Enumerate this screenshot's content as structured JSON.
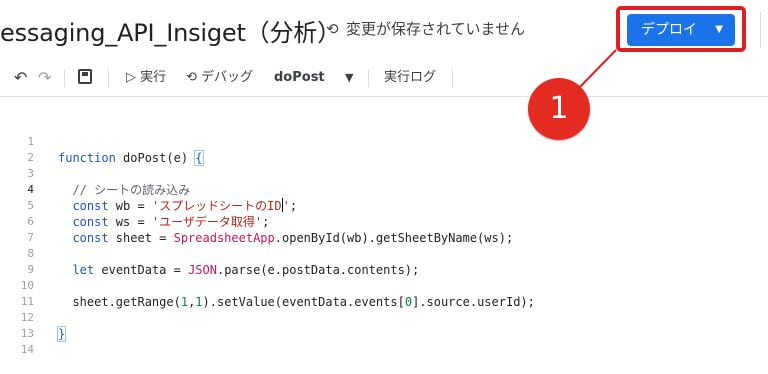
{
  "header": {
    "project_title": "essaging_API_Insiget（分析）",
    "save_status": "変更が保存されていません",
    "deploy_label": "デプロイ"
  },
  "toolbar": {
    "run_label": "▷ 実行",
    "debug_label": "⟲ デバッグ",
    "function_name": "doPost",
    "log_label": "実行ログ"
  },
  "editor": {
    "line_numbers": [
      "1",
      "2",
      "3",
      "4",
      "5",
      "6",
      "7",
      "8",
      "9",
      "10",
      "11",
      "12",
      "13",
      "14"
    ],
    "active_line": 4,
    "lines": [
      "function doPost(e) {",
      "",
      "  // シートの読み込み",
      "  const wb = 'スプレッドシートのID';",
      "  const ws = 'ユーザデータ取得';",
      "  const sheet = SpreadsheetApp.openById(wb).getSheetByName(ws);",
      "",
      "  let eventData = JSON.parse(e.postData.contents);",
      "",
      "  sheet.getRange(1,1).setValue(eventData.events[0].source.userId);",
      "",
      "}",
      "",
      ""
    ]
  },
  "annotation": {
    "badge_text": "1",
    "color": "#e42b22"
  },
  "colors": {
    "accent": "#1a73e8",
    "highlight": "#e02020"
  }
}
